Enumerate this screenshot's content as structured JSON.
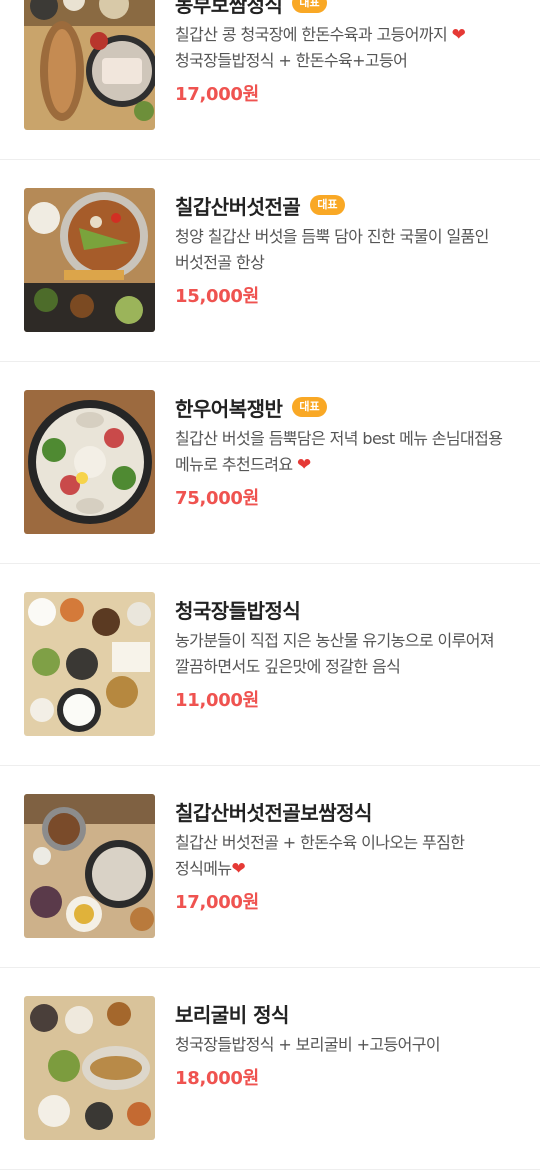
{
  "badge_label": "대표",
  "colors": {
    "badge": "#f9a825",
    "price": "#ef5350",
    "heart": "#e53935",
    "divider": "#eeeeee"
  },
  "items": [
    {
      "title": "농부보쌈정식",
      "badge": true,
      "desc": "칠갑산 콩 청국장에 한돈수육과 고등어까지",
      "desc_heart": true,
      "desc2": "청국장들밥정식 + 한돈수육+고등어",
      "price": "17,000원",
      "image_icon": "food-photo-icon"
    },
    {
      "title": "칠갑산버섯전골",
      "badge": true,
      "desc": "청양 칠갑산 버섯을 듬뿍 담아 진한 국물이 일품인 버섯전골 한상",
      "desc_heart": false,
      "desc2": "",
      "price": "15,000원",
      "image_icon": "food-photo-icon"
    },
    {
      "title": "한우어복쟁반",
      "badge": true,
      "desc": "칠갑산 버섯을 듬뿍담은 저녁 best 메뉴 손님대접용 메뉴로 추천드려요",
      "desc_heart": true,
      "desc2": "",
      "price": "75,000원",
      "image_icon": "food-photo-icon"
    },
    {
      "title": "청국장들밥정식",
      "badge": false,
      "desc": "농가분들이 직접 지은 농산물 유기농으로 이루어져 깔끔하면서도 깊은맛에 정갈한 음식",
      "desc_heart": false,
      "desc2": "",
      "price": "11,000원",
      "image_icon": "food-photo-icon"
    },
    {
      "title": "칠갑산버섯전골보쌈정식",
      "badge": false,
      "desc": "칠갑산 버섯전골 + 한돈수육 이나오는 푸짐한 정식메뉴",
      "desc_heart": true,
      "desc2": "",
      "price": "17,000원",
      "image_icon": "food-photo-icon"
    },
    {
      "title": "보리굴비 정식",
      "badge": false,
      "desc": "청국장들밥정식 + 보리굴비 +고등어구이",
      "desc_heart": false,
      "desc2": "",
      "price": "18,000원",
      "image_icon": "food-photo-icon"
    }
  ]
}
